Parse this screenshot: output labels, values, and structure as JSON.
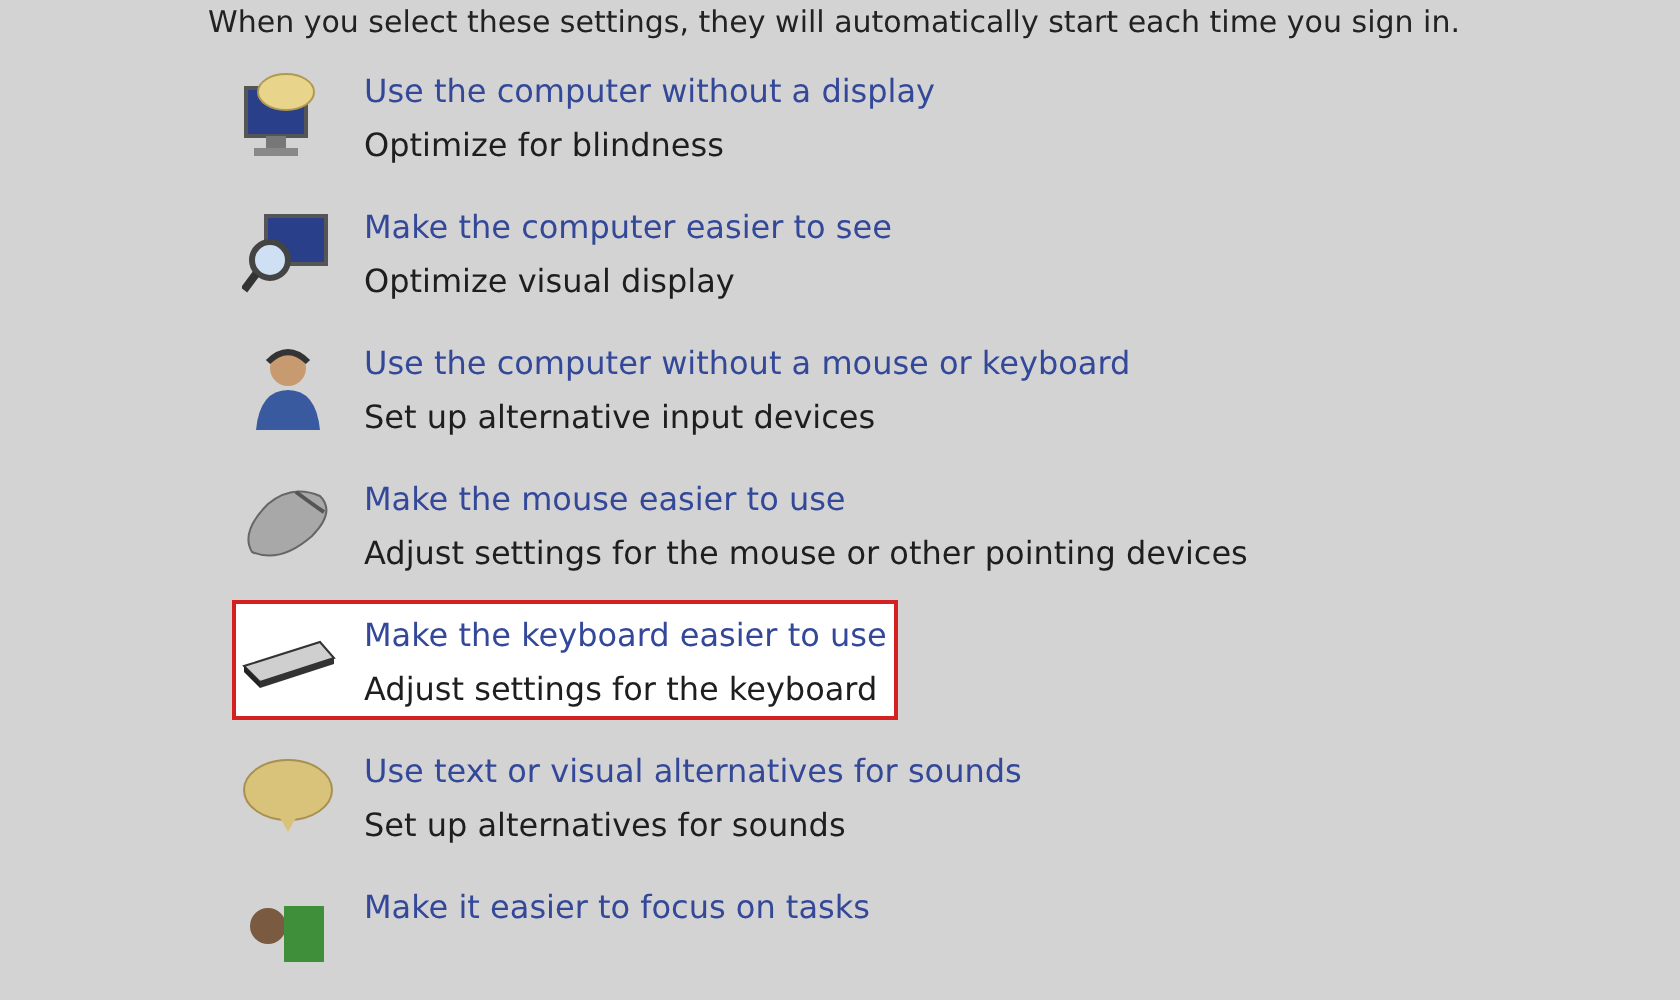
{
  "intro": "When you select these settings, they will automatically start each time you sign in.",
  "items": [
    {
      "kind": "display",
      "title": "Use the computer without a display",
      "description": "Optimize for blindness",
      "highlighted": false
    },
    {
      "kind": "magnifier",
      "title": "Make the computer easier to see",
      "description": "Optimize visual display",
      "highlighted": false
    },
    {
      "kind": "person",
      "title": "Use the computer without a mouse or keyboard",
      "description": "Set up alternative input devices",
      "highlighted": false
    },
    {
      "kind": "mouse",
      "title": "Make the mouse easier to use",
      "description": "Adjust settings for the mouse or other pointing devices",
      "highlighted": false
    },
    {
      "kind": "keyboard",
      "title": "Make the keyboard easier to use",
      "description": "Adjust settings for the keyboard",
      "highlighted": true
    },
    {
      "kind": "bubble",
      "title": "Use text or visual alternatives for sounds",
      "description": "Set up alternatives for sounds",
      "highlighted": false
    },
    {
      "kind": "focus",
      "title": "Make it easier to focus on tasks",
      "highlighted": false
    }
  ]
}
